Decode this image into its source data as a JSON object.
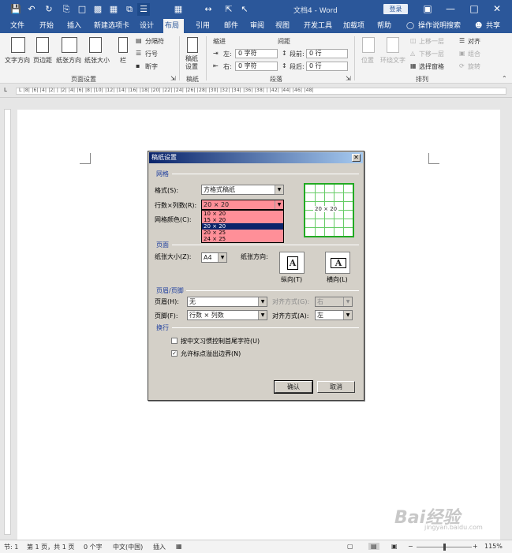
{
  "titlebar": {
    "doc_title": "文档4 - Word",
    "login": "登录",
    "quick_access": [
      "save-icon",
      "undo-icon",
      "redo-icon",
      "print-preview-icon",
      "new-doc-icon",
      "open-icon",
      "paste-icon",
      "copy-icon",
      "page-view-icon"
    ],
    "window_controls": [
      "ribbon-display-icon",
      "minimize-icon",
      "maximize-icon",
      "close-icon"
    ]
  },
  "menu": {
    "tabs": [
      "文件",
      "开始",
      "插入",
      "新建选项卡",
      "设计",
      "布局",
      "引用",
      "邮件",
      "审阅",
      "视图",
      "开发工具",
      "加载项",
      "帮助"
    ],
    "active_tab": "布局",
    "tell_me": "操作说明搜索",
    "share": "共享"
  },
  "ribbon": {
    "page_setup": {
      "text_direction": "文字方向",
      "margins": "页边距",
      "orientation": "纸张方向",
      "size": "纸张大小",
      "columns": "栏",
      "breaks": "分隔符",
      "line_numbers": "行号",
      "hyphenation": "断字",
      "group_label": "页面设置"
    },
    "manuscript": {
      "button": "稿纸设置",
      "group_label": "稿纸"
    },
    "paragraph": {
      "indent_label": "缩进",
      "spacing_label": "间距",
      "left_label": "左:",
      "left_value": "0 字符",
      "right_label": "右:",
      "right_value": "0 字符",
      "before_label": "段前:",
      "before_value": "0 行",
      "after_label": "段后:",
      "after_value": "0 行",
      "group_label": "段落"
    },
    "arrange": {
      "position": "位置",
      "wrap_text": "环绕文字",
      "bring_forward": "上移一层",
      "send_backward": "下移一层",
      "selection_pane": "选择窗格",
      "align": "对齐",
      "group": "组合",
      "rotate": "旋转",
      "group_label": "排列"
    }
  },
  "ruler": {
    "numbers": "L  |8|  |6|  |4|  |2|  |  |2|  |4|  |6|  |8|  |10|  |12|  |14|  |16|  |18|  |20|  |22|  |24|  |26|  |28|  |30|  |32|  |34|  |36|  |38|  |  |42|  |44|  |46|  |48|"
  },
  "dialog": {
    "title": "稿纸设置",
    "grid_section": "网格",
    "format_label": "格式(S):",
    "format_value": "方格式稿纸",
    "rowcol_label": "行数×列数(R):",
    "rowcol_value": "20 × 20",
    "rowcol_options": [
      "10 × 20",
      "15 × 20",
      "20 × 20",
      "20 × 25",
      "24 × 25"
    ],
    "rowcol_selected_index": 2,
    "grid_color_label": "网格颜色(C):",
    "preview_label": "20 × 20",
    "page_section": "页面",
    "paper_size_label": "纸张大小(Z):",
    "paper_size_value": "A4",
    "orientation_label": "纸张方向:",
    "portrait_label": "纵向(T)",
    "landscape_label": "横向(L)",
    "orientation_glyph": "A",
    "header_footer_section": "页眉/页脚",
    "header_label": "页眉(H):",
    "header_value": "无",
    "header_align_label": "对齐方式(G):",
    "header_align_value": "右",
    "footer_label": "页脚(F):",
    "footer_value": "行数 × 列数",
    "footer_align_label": "对齐方式(A):",
    "footer_align_value": "左",
    "wrap_section": "换行",
    "check1_label": "按中文习惯控制首尾字符(U)",
    "check1_checked": false,
    "check2_label": "允许标点溢出边界(N)",
    "check2_checked": true,
    "ok": "确认",
    "cancel": "取消",
    "accent_color": "#1f3f9f",
    "highlight_color": "#ff8f98",
    "preview_color": "#22aa22"
  },
  "statusbar": {
    "section": "节: 1",
    "page": "第 1 页，共 1 页",
    "words": "0 个字",
    "language": "中文(中国)",
    "mode": "插入",
    "zoom": "115%"
  },
  "watermark": {
    "text": "Bai经验",
    "sub": "jingyan.baidu.com"
  }
}
